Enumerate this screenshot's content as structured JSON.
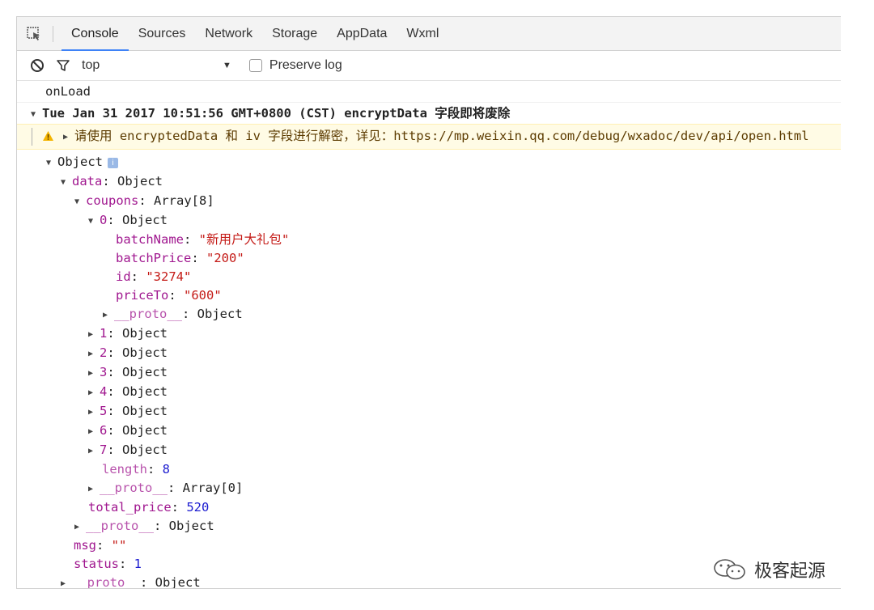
{
  "tabs": [
    "Console",
    "Sources",
    "Network",
    "Storage",
    "AppData",
    "Wxml"
  ],
  "toolbar": {
    "context": "top",
    "preserve_log_label": "Preserve log"
  },
  "console": {
    "onload": "onLoad",
    "group_header": "Tue Jan 31 2017 10:51:56 GMT+0800 (CST) encryptData 字段即将废除",
    "warning": "请使用 encryptedData 和 iv 字段进行解密，详见：https://mp.weixin.qq.com/debug/wxadoc/dev/api/open.html",
    "object_label": "Object",
    "tree": {
      "data_key": "data",
      "data_val": "Object",
      "coupons_key": "coupons",
      "coupons_val": "Array[8]",
      "item0": {
        "idx": "0",
        "val": "Object"
      },
      "batchName_key": "batchName",
      "batchName_val": "\"新用户大礼包\"",
      "batchPrice_key": "batchPrice",
      "batchPrice_val": "\"200\"",
      "id_key": "id",
      "id_val": "\"3274\"",
      "priceTo_key": "priceTo",
      "priceTo_val": "\"600\"",
      "proto_key": "__proto__",
      "proto_obj": "Object",
      "items": [
        {
          "idx": "1",
          "val": "Object"
        },
        {
          "idx": "2",
          "val": "Object"
        },
        {
          "idx": "3",
          "val": "Object"
        },
        {
          "idx": "4",
          "val": "Object"
        },
        {
          "idx": "5",
          "val": "Object"
        },
        {
          "idx": "6",
          "val": "Object"
        },
        {
          "idx": "7",
          "val": "Object"
        }
      ],
      "length_key": "length",
      "length_val": "8",
      "proto_arr": "Array[0]",
      "total_price_key": "total_price",
      "total_price_val": "520",
      "msg_key": "msg",
      "msg_val": "\"\"",
      "status_key": "status",
      "status_val": "1"
    }
  },
  "watermark": "极客起源",
  "colors": {
    "accent": "#3e82f7",
    "key": "#a0178f",
    "string": "#c41a16",
    "number": "#1c1cd0",
    "warning_bg": "#fffbe5"
  }
}
